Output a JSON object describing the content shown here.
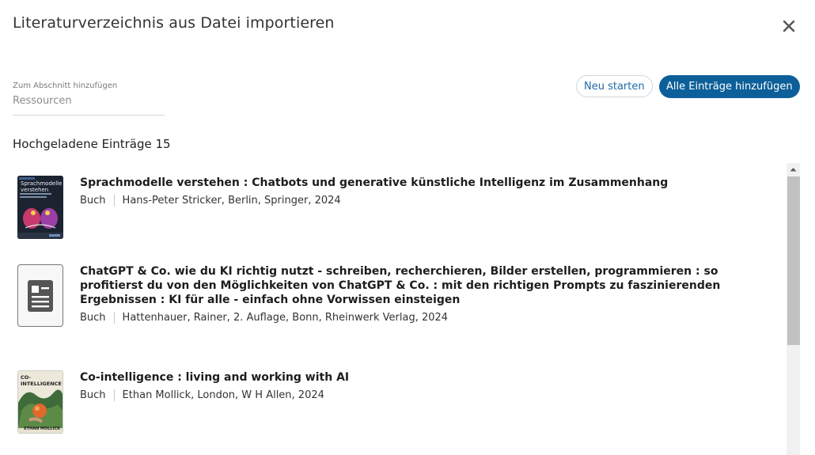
{
  "dialog": {
    "title": "Literaturverzeichnis aus Datei importieren",
    "close_icon": "close-icon"
  },
  "section_field": {
    "label": "Zum Abschnitt hinzufügen",
    "value": "Ressourcen"
  },
  "actions": {
    "restart_label": "Neu starten",
    "add_all_label": "Alle Einträge hinzufügen",
    "add_all_color": "#0c5f99"
  },
  "uploaded": {
    "heading": "Hochgeladene Einträge 15"
  },
  "entries": [
    {
      "title": "Sprachmodelle verstehen : Chatbots und generative künstliche Intelligenz im Zusammenhang",
      "type": "Buch",
      "details": "Hans-Peter Stricker, Berlin, Springer, 2024",
      "cover_text": "Sprachmodelle verstehen"
    },
    {
      "title": "ChatGPT & Co. wie du KI richtig nutzt - schreiben, recherchieren, Bilder erstellen, programmieren : so profitierst du von den Möglichkeiten von ChatGPT & Co. : mit den richtigen Prompts zu faszinierenden Ergebnissen : KI für alle - einfach ohne Vorwissen einsteigen",
      "type": "Buch",
      "details": "Hattenhauer, Rainer, 2. Auflage, Bonn, Rheinwerk Verlag, 2024",
      "cover_icon": "document-icon"
    },
    {
      "title": "Co-intelligence : living and working with AI",
      "type": "Buch",
      "details": "Ethan Mollick, London, W H Allen, 2024",
      "cover_text": "CO-INTELLIGENCE",
      "cover_author": "ETHAN MOLLICK"
    }
  ]
}
